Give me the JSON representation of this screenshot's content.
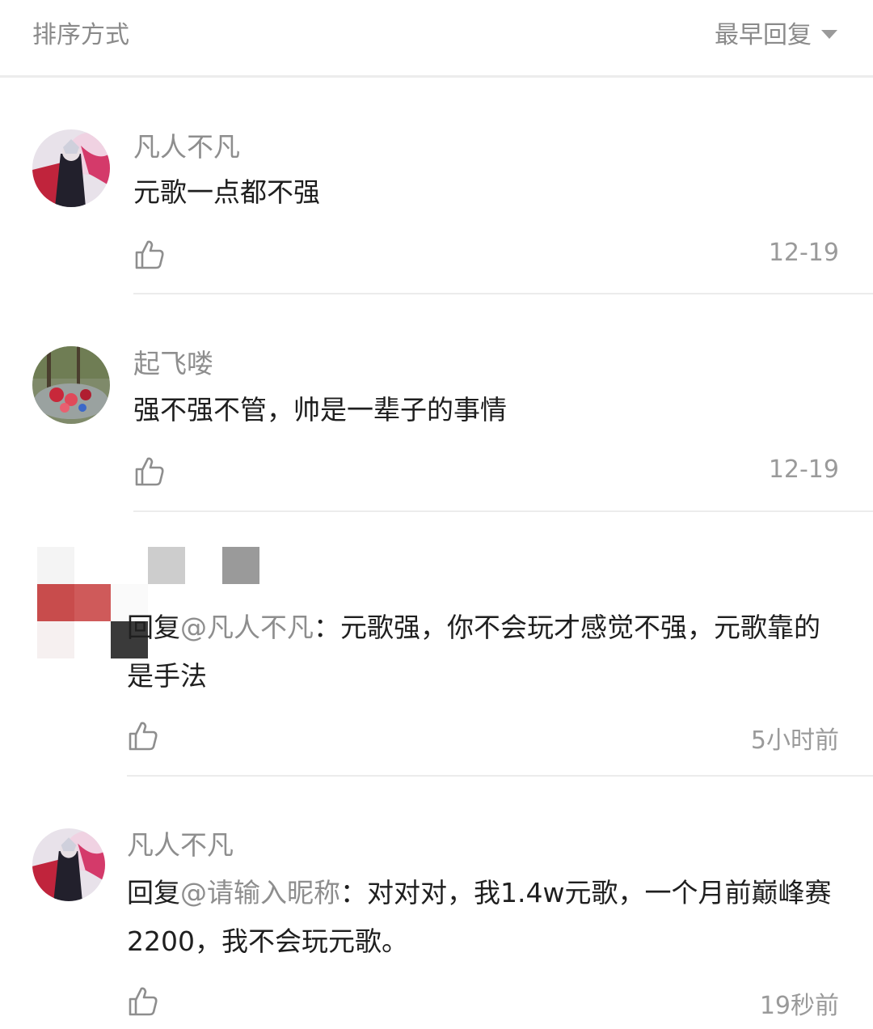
{
  "sort": {
    "label": "排序方式",
    "selected": "最早回复"
  },
  "comments": [
    {
      "username": "凡人不凡",
      "text": "元歌一点都不强",
      "time": "12-19"
    },
    {
      "username": "起飞喽",
      "text": "强不强不管，帅是一辈子的事情",
      "time": "12-19"
    },
    {
      "username": "",
      "reply_prefix": "回复",
      "mention": "@凡人不凡",
      "text": "：元歌强，你不会玩才感觉不强，元歌靠的是手法",
      "time": "5小时前"
    },
    {
      "username": "凡人不凡",
      "reply_prefix": "回复",
      "mention": "@请输入昵称",
      "text": "：对对对，我1.4w元歌，一个月前巅峰赛2200，我不会玩元歌。",
      "time": "19秒前"
    }
  ],
  "icons": {
    "like": "thumbs-up-icon",
    "sort": "triangle-down-icon"
  },
  "colors": {
    "muted": "#8e8e8e",
    "text": "#1f1f1f",
    "divider": "#ececec"
  }
}
